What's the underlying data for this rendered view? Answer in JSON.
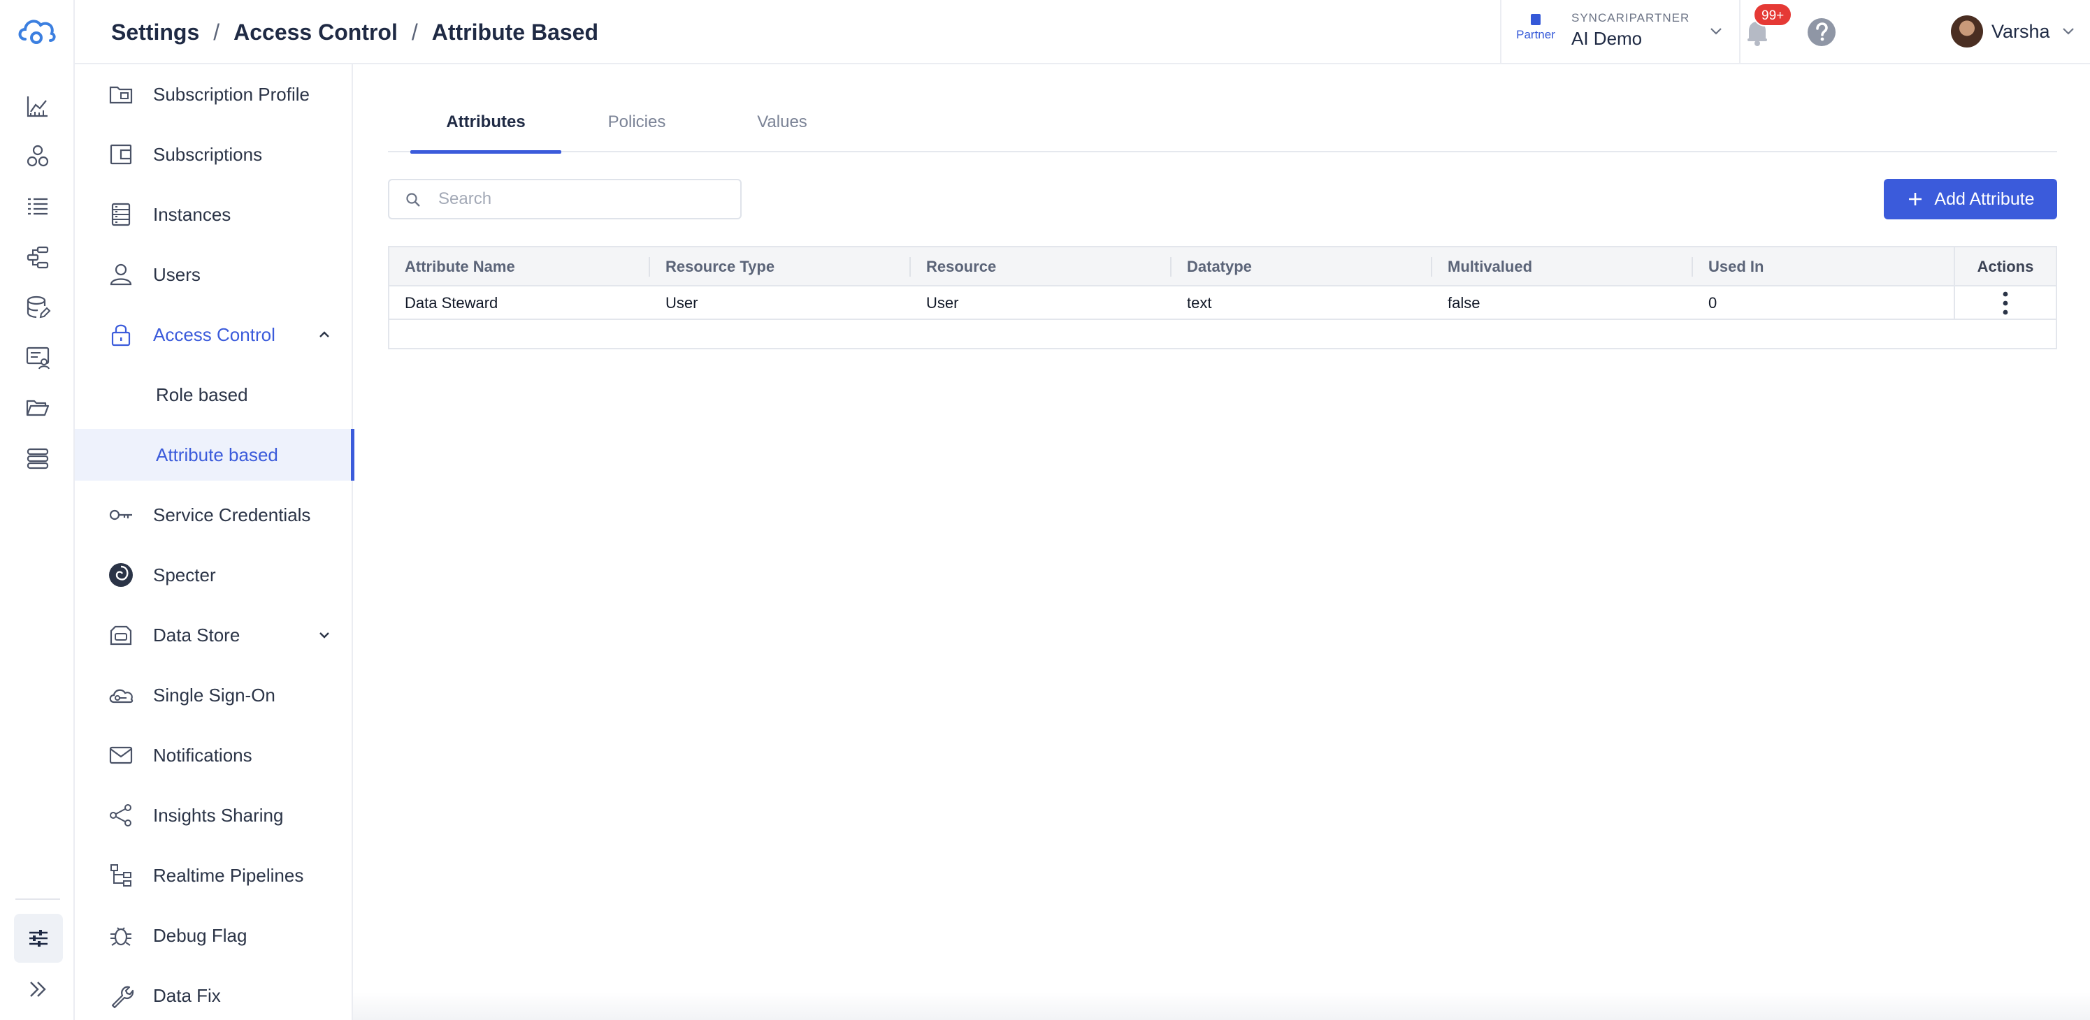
{
  "breadcrumb": {
    "items": [
      "Settings",
      "Access Control",
      "Attribute Based"
    ],
    "separator": "/"
  },
  "org": {
    "badge": "Partner",
    "label": "SYNCARIPARTNER",
    "name": "AI Demo"
  },
  "notifications": {
    "badge": "99+"
  },
  "user": {
    "name": "Varsha"
  },
  "rail": {
    "items": [
      "dashboard-chart-icon",
      "entities-icon",
      "list-icon",
      "pipeline-icon",
      "database-edit-icon",
      "monitor-user-icon",
      "folder-icon",
      "stack-icon"
    ],
    "settings_icon": "sliders-icon",
    "expand_icon": "double-chevron-right-icon"
  },
  "settings_nav": {
    "items": [
      {
        "label": "Subscription Profile",
        "icon": "folder-card-icon"
      },
      {
        "label": "Subscriptions",
        "icon": "wallet-icon"
      },
      {
        "label": "Instances",
        "icon": "server-icon"
      },
      {
        "label": "Users",
        "icon": "user-icon"
      },
      {
        "label": "Access Control",
        "icon": "lock-icon",
        "expanded": true
      },
      {
        "label": "Role based",
        "sub": true
      },
      {
        "label": "Attribute based",
        "sub": true,
        "selected": true
      },
      {
        "label": "Service Credentials",
        "icon": "key-icon"
      },
      {
        "label": "Specter",
        "icon": "specter-icon"
      },
      {
        "label": "Data Store",
        "icon": "datastore-icon",
        "collapsed": true
      },
      {
        "label": "Single Sign-On",
        "icon": "cloud-key-icon"
      },
      {
        "label": "Notifications",
        "icon": "mail-icon"
      },
      {
        "label": "Insights Sharing",
        "icon": "share-icon"
      },
      {
        "label": "Realtime Pipelines",
        "icon": "tree-icon"
      },
      {
        "label": "Debug Flag",
        "icon": "bug-icon"
      },
      {
        "label": "Data Fix",
        "icon": "wrench-icon"
      }
    ]
  },
  "tabs": [
    {
      "label": "Attributes",
      "active": true
    },
    {
      "label": "Policies",
      "active": false
    },
    {
      "label": "Values",
      "active": false
    }
  ],
  "search": {
    "placeholder": "Search",
    "value": ""
  },
  "add_button": {
    "label": "Add Attribute"
  },
  "table": {
    "columns": [
      "Attribute Name",
      "Resource Type",
      "Resource",
      "Datatype",
      "Multivalued",
      "Used In",
      "Actions"
    ],
    "rows": [
      [
        "Data Steward",
        "User",
        "User",
        "text",
        "false",
        "0"
      ]
    ]
  },
  "colors": {
    "accent": "#3b5bdb",
    "badge": "#e53935",
    "text": "#1f2a44",
    "border": "#e3e6ec"
  }
}
